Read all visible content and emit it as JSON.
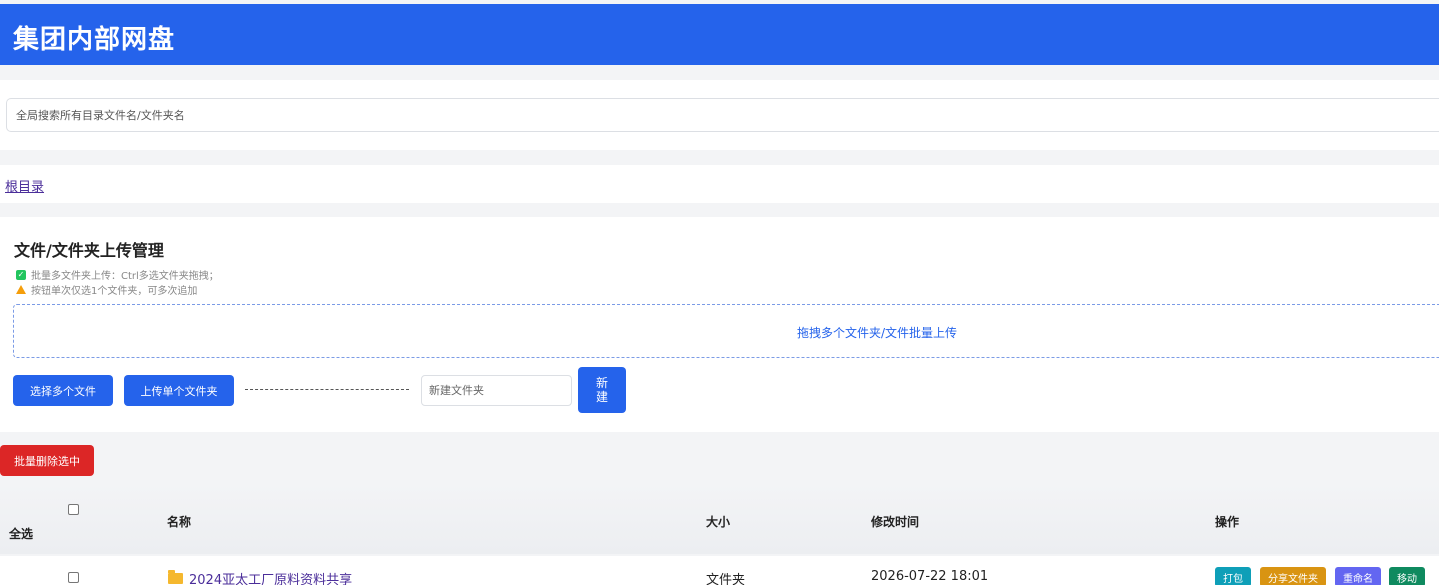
{
  "app": {
    "title": "集团内部网盘"
  },
  "search": {
    "placeholder": "全局搜索所有目录文件名/文件夹名"
  },
  "breadcrumb": {
    "root": "根目录"
  },
  "upload": {
    "title": "文件/文件夹上传管理",
    "tip_batch": "批量多文件夹上传：Ctrl多选文件夹拖拽；",
    "tip_single": "按钮单次仅选1个文件夹，可多次追加",
    "dropzone_text": "拖拽多个文件夹/文件批量上传",
    "select_files_label": "选择多个文件",
    "upload_folder_label": "上传单个文件夹",
    "new_folder_placeholder": "新建文件夹",
    "new_label_line1": "新",
    "new_label_line2": "建"
  },
  "batch_delete_label": "批量删除选中",
  "table": {
    "columns": {
      "select_all": "全选",
      "name": "名称",
      "size": "大小",
      "modified": "修改时间",
      "actions": "操作"
    },
    "rows": [
      {
        "name": "2024亚太工厂原料资料共享",
        "size": "文件夹",
        "modified": "2026-07-22 18:01",
        "icon": "folder-icon"
      }
    ],
    "actions": {
      "pack": "打包",
      "share": "分享文件夹",
      "rename": "重命名",
      "move": "移动"
    }
  },
  "colors": {
    "primary": "#2563eb",
    "danger": "#dc2626",
    "pack": "#0e9fb8",
    "share": "#d99412",
    "rename": "#6366f1",
    "move": "#0f8a5f"
  }
}
